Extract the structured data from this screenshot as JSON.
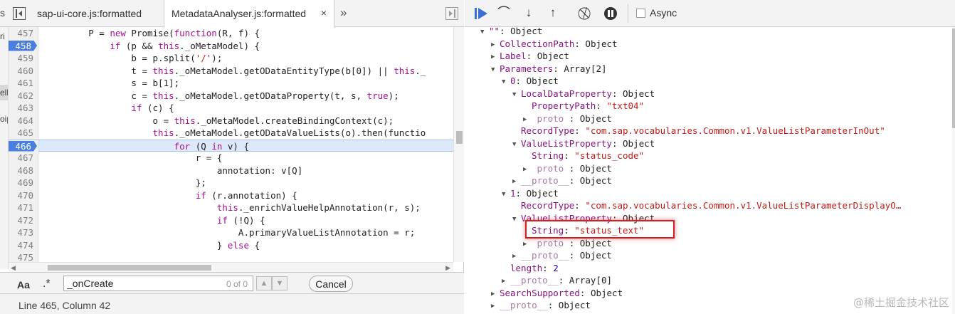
{
  "source_panel": {
    "tabs": [
      {
        "label": "sap-ui-core.js:formatted",
        "active": false
      },
      {
        "label": "MetadataAnalyser.js:formatted",
        "active": true,
        "close": "×"
      }
    ],
    "left_cut_tab": "s",
    "more_tabs_glyph": "»",
    "left_strip": [
      "ri",
      "ell",
      "oip"
    ],
    "lines": [
      {
        "num": "457",
        "code": "        P = new Promise(function(R, f) {"
      },
      {
        "num": "458",
        "code": "            if (p && this._oMetaModel) {",
        "breakpoint": true
      },
      {
        "num": "459",
        "code": "                b = p.split('/');"
      },
      {
        "num": "460",
        "code": "                t = this._oMetaModel.getODataEntityType(b[0]) || this._"
      },
      {
        "num": "461",
        "code": "                s = b[1];"
      },
      {
        "num": "462",
        "code": "                c = this._oMetaModel.getODataProperty(t, s, true);"
      },
      {
        "num": "463",
        "code": "                if (c) {"
      },
      {
        "num": "464",
        "code": "                    o = this._oMetaModel.createBindingContext(c);"
      },
      {
        "num": "465",
        "code": "                    this._oMetaModel.getODataValueLists(o).then(functio"
      },
      {
        "num": "466",
        "code": "                        for (Q in v) {",
        "breakpoint": true,
        "current": true
      },
      {
        "num": "467",
        "code": "                            r = {"
      },
      {
        "num": "468",
        "code": "                                annotation: v[Q]"
      },
      {
        "num": "469",
        "code": "                            };"
      },
      {
        "num": "470",
        "code": "                            if (r.annotation) {"
      },
      {
        "num": "471",
        "code": "                                this._enrichValueHelpAnnotation(r, s);"
      },
      {
        "num": "472",
        "code": "                                if (!Q) {"
      },
      {
        "num": "473",
        "code": "                                    A.primaryValueListAnnotation = r;"
      },
      {
        "num": "474",
        "code": "                                } else {"
      },
      {
        "num": "475",
        "code": ""
      }
    ],
    "search": {
      "case_label": "Aa",
      "regex_label": ".*",
      "query": "_onCreate",
      "match_count": "0 of 0",
      "cancel_label": "Cancel"
    },
    "status": "Line 465, Column 42"
  },
  "debugger": {
    "async_label": "Async",
    "scope_rows": [
      {
        "indent": 0,
        "tri": "down",
        "name": "\"\"",
        "sep": ": ",
        "value": "Object",
        "vtype": "o"
      },
      {
        "indent": 1,
        "tri": "right",
        "name": "CollectionPath",
        "sep": ": ",
        "value": "Object",
        "vtype": "o"
      },
      {
        "indent": 1,
        "tri": "right",
        "name": "Label",
        "sep": ": ",
        "value": "Object",
        "vtype": "o"
      },
      {
        "indent": 1,
        "tri": "down",
        "name": "Parameters",
        "sep": ": ",
        "value": "Array[2]",
        "vtype": "o"
      },
      {
        "indent": 2,
        "tri": "down",
        "name": "0",
        "sep": ": ",
        "value": "Object",
        "vtype": "o"
      },
      {
        "indent": 3,
        "tri": "down",
        "name": "LocalDataProperty",
        "sep": ": ",
        "value": "Object",
        "vtype": "o"
      },
      {
        "indent": 4,
        "tri": "none",
        "name": "PropertyPath",
        "sep": ": ",
        "value": "\"txt04\"",
        "vtype": "s"
      },
      {
        "indent": 4,
        "tri": "right",
        "name": "  proto  ",
        "sep": ": ",
        "value": "Object",
        "vtype": "o",
        "dim": true
      },
      {
        "indent": 3,
        "tri": "none",
        "name": "RecordType",
        "sep": ": ",
        "value": "\"com.sap.vocabularies.Common.v1.ValueListParameterInOut\"",
        "vtype": "s"
      },
      {
        "indent": 3,
        "tri": "down",
        "name": "ValueListProperty",
        "sep": ": ",
        "value": "Object",
        "vtype": "o"
      },
      {
        "indent": 4,
        "tri": "none",
        "name": "String",
        "sep": ": ",
        "value": "\"status_code\"",
        "vtype": "s"
      },
      {
        "indent": 4,
        "tri": "right",
        "name": "  proto  ",
        "sep": ": ",
        "value": "Object",
        "vtype": "o",
        "dim": true
      },
      {
        "indent": 3,
        "tri": "right",
        "name": "__proto__",
        "sep": ": ",
        "value": "Object",
        "vtype": "o",
        "dim": true
      },
      {
        "indent": 2,
        "tri": "down",
        "name": "1",
        "sep": ": ",
        "value": "Object",
        "vtype": "o"
      },
      {
        "indent": 3,
        "tri": "none",
        "name": "RecordType",
        "sep": ": ",
        "value": "\"com.sap.vocabularies.Common.v1.ValueListParameterDisplayO…",
        "vtype": "s"
      },
      {
        "indent": 3,
        "tri": "down",
        "name": "ValueListProperty",
        "sep": ": ",
        "value": "Object",
        "vtype": "o"
      },
      {
        "indent": 4,
        "tri": "none",
        "name": "String",
        "sep": ": ",
        "value": "\"status_text\"",
        "vtype": "s"
      },
      {
        "indent": 4,
        "tri": "right",
        "name": "  proto  ",
        "sep": ": ",
        "value": "Object",
        "vtype": "o",
        "dim": true
      },
      {
        "indent": 3,
        "tri": "right",
        "name": "__proto__",
        "sep": ": ",
        "value": "Object",
        "vtype": "o",
        "dim": true
      },
      {
        "indent": 2,
        "tri": "none",
        "name": "length",
        "sep": ": ",
        "value": "2",
        "vtype": "n"
      },
      {
        "indent": 2,
        "tri": "right",
        "name": "__proto__",
        "sep": ": ",
        "value": "Array[0]",
        "vtype": "o",
        "dim": true
      },
      {
        "indent": 1,
        "tri": "right",
        "name": "SearchSupported",
        "sep": ": ",
        "value": "Object",
        "vtype": "o"
      },
      {
        "indent": 1,
        "tri": "right",
        "name": "__proto__",
        "sep": ": ",
        "value": "Object",
        "vtype": "o",
        "dim": true
      }
    ]
  },
  "watermark": "@稀土掘金技术社区",
  "colors": {
    "breakpoint": "#4a7fe0",
    "current_line": "#dde8fa",
    "property_name": "#881280",
    "string_value": "#c41a16",
    "number_value": "#1c00cf",
    "highlight_box": "#d32020"
  },
  "icons": {
    "toolbar": [
      "resume-icon",
      "step-over-icon",
      "step-into-icon",
      "step-out-icon",
      "deactivate-breakpoints-icon",
      "pause-on-exceptions-icon"
    ]
  }
}
